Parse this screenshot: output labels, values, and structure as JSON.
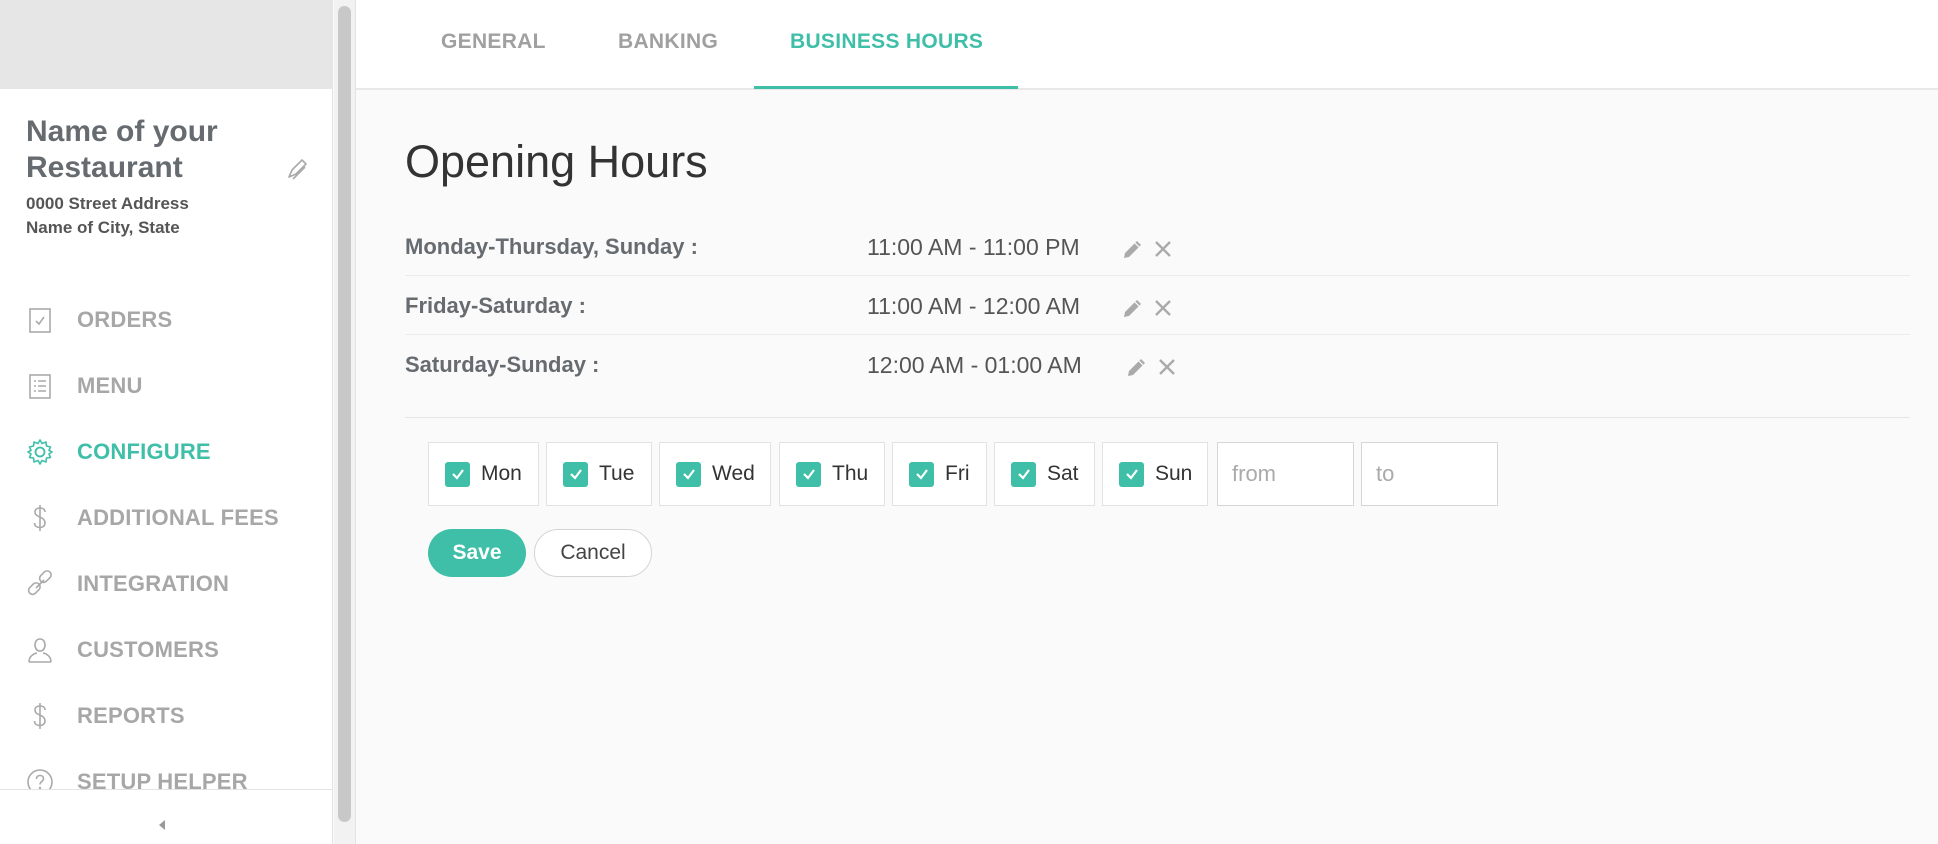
{
  "restaurant": {
    "name": "Name of your Restaurant",
    "address_line1": "0000 Street Address",
    "address_line2": "Name of City, State"
  },
  "sidebar": {
    "items": [
      {
        "label": "ORDERS",
        "icon": "checkbox-icon",
        "active": false
      },
      {
        "label": "MENU",
        "icon": "list-icon",
        "active": false
      },
      {
        "label": "CONFIGURE",
        "icon": "gear-icon",
        "active": true
      },
      {
        "label": "ADDITIONAL FEES",
        "icon": "dollar-icon",
        "active": false
      },
      {
        "label": "INTEGRATION",
        "icon": "link-icon",
        "active": false
      },
      {
        "label": "CUSTOMERS",
        "icon": "user-icon",
        "active": false
      },
      {
        "label": "REPORTS",
        "icon": "dollar-icon",
        "active": false
      },
      {
        "label": "SETUP HELPER",
        "icon": "help-icon",
        "active": false
      }
    ]
  },
  "tabs": [
    {
      "label": "GENERAL",
      "active": false
    },
    {
      "label": "BANKING",
      "active": false
    },
    {
      "label": "BUSINESS HOURS",
      "active": true
    }
  ],
  "page": {
    "title": "Opening Hours"
  },
  "hours": [
    {
      "days": "Monday-Thursday, Sunday :",
      "time": "11:00 AM - 11:00 PM"
    },
    {
      "days": "Friday-Saturday :",
      "time": "11:00 AM - 12:00 AM"
    },
    {
      "days": "Saturday-Sunday :",
      "time": "12:00 AM - 01:00 AM"
    }
  ],
  "form": {
    "days": [
      {
        "label": "Mon",
        "checked": true
      },
      {
        "label": "Tue",
        "checked": true
      },
      {
        "label": "Wed",
        "checked": true
      },
      {
        "label": "Thu",
        "checked": true
      },
      {
        "label": "Fri",
        "checked": true
      },
      {
        "label": "Sat",
        "checked": true
      },
      {
        "label": "Sun",
        "checked": true
      }
    ],
    "from_placeholder": "from",
    "to_placeholder": "to",
    "save_label": "Save",
    "cancel_label": "Cancel"
  },
  "colors": {
    "accent": "#3fbfa8",
    "muted": "#a7a7a7"
  }
}
